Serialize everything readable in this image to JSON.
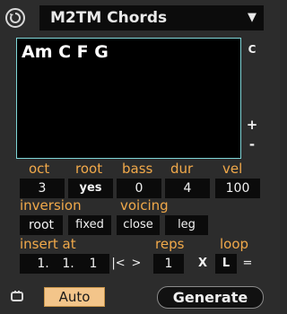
{
  "header": {
    "reset_icon": "circular-arrow-icon",
    "device_name": "M2TM Chords",
    "dropdown_icon": "triangle-down-icon"
  },
  "display": {
    "chords": "Am C F G",
    "clear_label": "C",
    "plus_label": "+",
    "minus_label": "-"
  },
  "params": {
    "oct": {
      "label": "oct",
      "value": "3"
    },
    "root": {
      "label": "root",
      "value": "yes"
    },
    "bass": {
      "label": "bass",
      "value": "0"
    },
    "dur": {
      "label": "dur",
      "value": "4"
    },
    "vel": {
      "label": "vel",
      "value": "100"
    }
  },
  "inversion": {
    "label": "inversion",
    "value": "root",
    "option": "fixed"
  },
  "voicing": {
    "label": "voicing",
    "value": "close",
    "option": "leg"
  },
  "insert": {
    "label": "insert at",
    "bar": "1.",
    "beat": "1.",
    "sixteenth": "1",
    "nav_back": "|<",
    "nav_fwd": ">"
  },
  "reps": {
    "label": "reps",
    "value": "1",
    "clear": "X"
  },
  "loop": {
    "label": "loop",
    "value": "L",
    "equals": "="
  },
  "footer": {
    "auto_label": "Auto",
    "generate_label": "Generate",
    "lock_icon": "link-icon"
  },
  "colors": {
    "accent_label": "#f1a94a",
    "border_cyan": "#7fd6d8",
    "auto_bg": "#f3c58a"
  }
}
